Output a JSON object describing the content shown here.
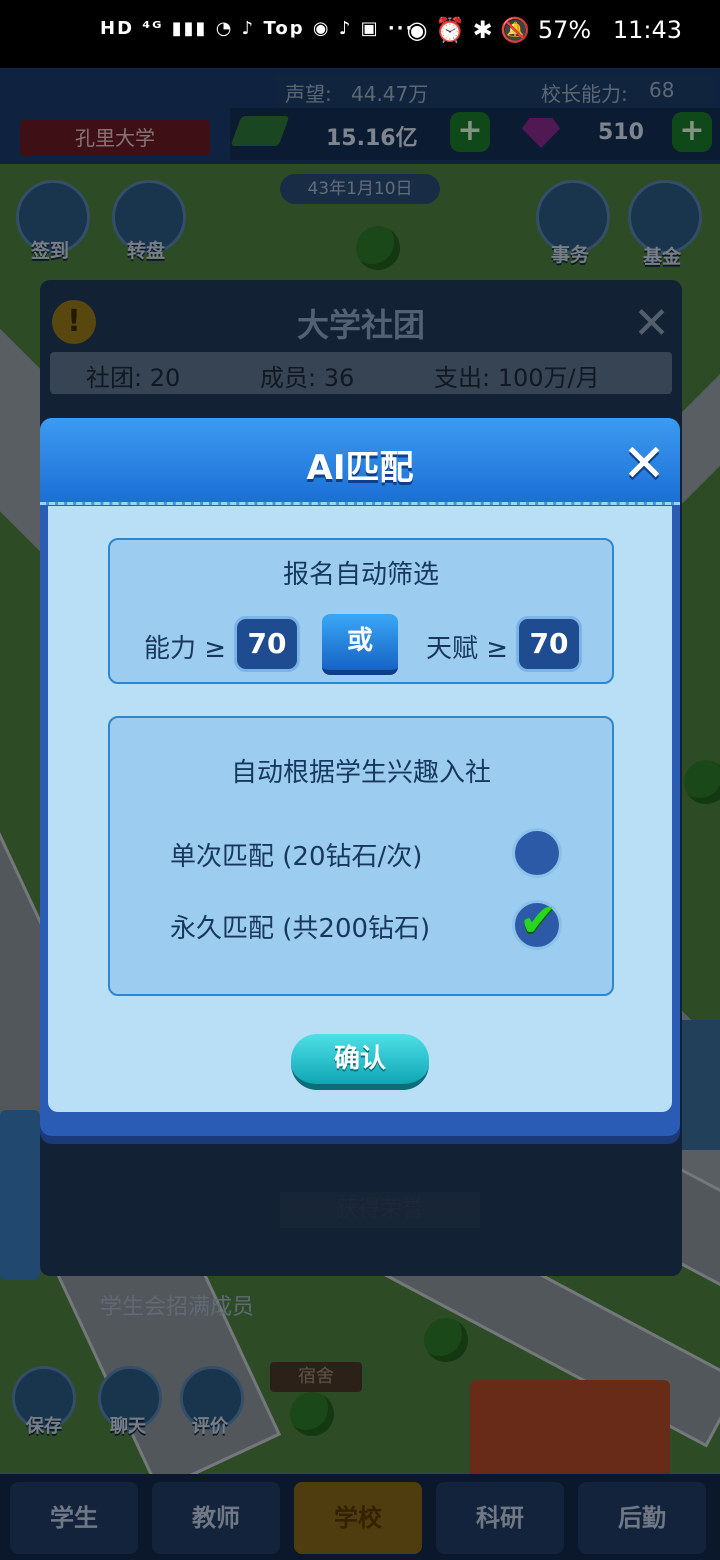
{
  "status_bar": {
    "left_icons": "HD ⁴ᴳ ▮▮▮ ◔ ♪ Top ◉ ♪ ▣ ···",
    "right_icons": "◉ ⏰ ✱ 🔕",
    "battery": "57%",
    "time": "11:43"
  },
  "hud": {
    "school_name": "孔里大学",
    "reputation_label": "声望:",
    "reputation_value": "44.47万",
    "principal_label": "校长能力:",
    "principal_value": "68",
    "money": "15.16亿",
    "diamonds": "510",
    "plus": "+",
    "date": "43年1月10日"
  },
  "side_buttons": {
    "checkin": "签到",
    "wheel": "转盘",
    "affairs": "事务",
    "fund": "基金"
  },
  "club_dialog": {
    "title": "大学社团",
    "clubs": "社团: 20",
    "members": "成员: 36",
    "expense": "支出: 100万/月",
    "honor": "获得荣誉"
  },
  "task_banner": "学生会招满成员",
  "dorm_label": "宿舍",
  "bottom_tools": {
    "save": "保存",
    "chat": "聊天",
    "review": "评价"
  },
  "bottom_nav": [
    {
      "label": "学生"
    },
    {
      "label": "教师"
    },
    {
      "label": "学校"
    },
    {
      "label": "科研"
    },
    {
      "label": "后勤"
    }
  ],
  "modal": {
    "title": "AI匹配",
    "close": "✕",
    "filter": {
      "title": "报名自动筛选",
      "ability_label": "能力 ≥",
      "ability_value": "70",
      "or_label": "或",
      "talent_label": "天赋 ≥",
      "talent_value": "70"
    },
    "interest": {
      "title": "自动根据学生兴趣入社",
      "single_label": "单次匹配 (20钻石/次)",
      "permanent_label": "永久匹配 (共200钻石)",
      "single_checked": false,
      "permanent_checked": true
    },
    "confirm": "确认"
  },
  "colors": {
    "modal_header": "#1c6fd5",
    "modal_body": "#b9dff7",
    "confirm": "#0fa6b5",
    "check": "#26d61f"
  }
}
